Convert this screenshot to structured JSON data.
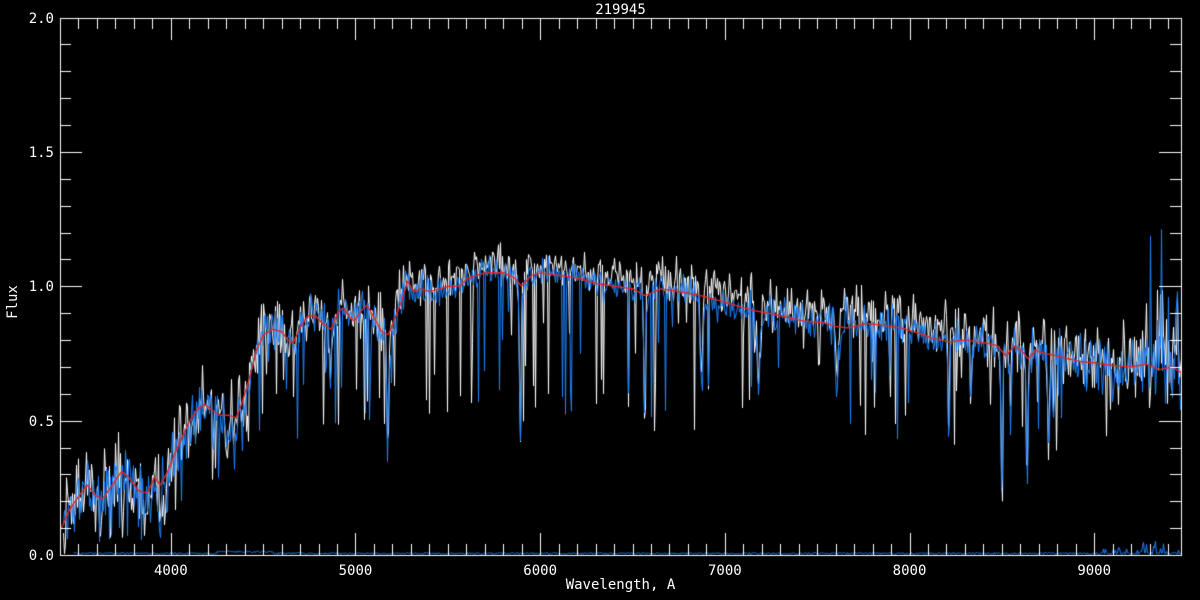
{
  "window": {
    "title": "219945"
  },
  "chart_data": {
    "type": "line",
    "title": "219945",
    "xlabel": "Wavelength, A",
    "ylabel": "Flux",
    "xlim": [
      3400,
      9470
    ],
    "ylim": [
      0.0,
      2.0
    ],
    "grid": false,
    "legend": null,
    "background_color": "#000000",
    "axis_color": "#ffffff",
    "x_major_ticks": [
      4000,
      5000,
      6000,
      7000,
      8000,
      9000
    ],
    "x_tick_labels": [
      "4000",
      "5000",
      "6000",
      "7000",
      "8000",
      "9000"
    ],
    "x_minor_step": 100,
    "y_major_ticks": [
      0.0,
      0.5,
      1.0,
      1.5,
      2.0
    ],
    "y_tick_labels": [
      "0.0",
      "0.5",
      "1.0",
      "1.5",
      "2.0"
    ],
    "y_minor_step": 0.1,
    "data_start": 3415,
    "continuum_x": [
      3405,
      3450,
      3500,
      3545,
      3590,
      3630,
      3680,
      3730,
      3770,
      3820,
      3870,
      3910,
      3940,
      3980,
      4020,
      4060,
      4100,
      4140,
      4180,
      4220,
      4260,
      4310,
      4350,
      4380,
      4420,
      4460,
      4500,
      4550,
      4600,
      4630,
      4660,
      4700,
      4740,
      4780,
      4820,
      4865,
      4900,
      4930,
      4960,
      4990,
      5030,
      5060,
      5100,
      5140,
      5175,
      5210,
      5250,
      5280,
      5310,
      5350,
      5400,
      5450,
      5500,
      5560,
      5605,
      5650,
      5700,
      5750,
      5800,
      5860,
      5895,
      5950,
      6000,
      6100,
      6200,
      6300,
      6400,
      6500,
      6565,
      6650,
      6750,
      6865,
      6950,
      7050,
      7150,
      7230,
      7330,
      7430,
      7530,
      7600,
      7665,
      7770,
      7850,
      7950,
      8050,
      8120,
      8210,
      8300,
      8400,
      8470,
      8520,
      8560,
      8600,
      8640,
      8680,
      8700,
      8800,
      8920,
      9000,
      9100,
      9200,
      9280,
      9350,
      9420,
      9465
    ],
    "continuum_y": [
      0.1,
      0.17,
      0.22,
      0.26,
      0.22,
      0.21,
      0.26,
      0.31,
      0.29,
      0.24,
      0.23,
      0.29,
      0.26,
      0.31,
      0.38,
      0.44,
      0.5,
      0.54,
      0.56,
      0.54,
      0.52,
      0.52,
      0.51,
      0.56,
      0.65,
      0.76,
      0.82,
      0.84,
      0.83,
      0.8,
      0.79,
      0.85,
      0.89,
      0.89,
      0.86,
      0.84,
      0.9,
      0.92,
      0.89,
      0.87,
      0.91,
      0.93,
      0.88,
      0.83,
      0.82,
      0.88,
      0.95,
      1.02,
      0.98,
      0.99,
      0.98,
      0.99,
      1.0,
      1.0,
      1.03,
      1.04,
      1.05,
      1.05,
      1.05,
      1.03,
      1.0,
      1.04,
      1.05,
      1.04,
      1.03,
      1.01,
      1.0,
      0.99,
      0.965,
      0.99,
      0.98,
      0.965,
      0.95,
      0.93,
      0.91,
      0.9,
      0.885,
      0.87,
      0.865,
      0.85,
      0.845,
      0.862,
      0.855,
      0.845,
      0.825,
      0.807,
      0.793,
      0.8,
      0.79,
      0.78,
      0.74,
      0.775,
      0.765,
      0.73,
      0.762,
      0.755,
      0.74,
      0.72,
      0.715,
      0.705,
      0.7,
      0.71,
      0.69,
      0.7,
      0.68
    ],
    "noise_amp_x": [
      3405,
      4000,
      4400,
      4800,
      5300,
      5800,
      6300,
      6900,
      7400,
      7900,
      8400,
      8900,
      9150,
      9470
    ],
    "noise_amp_y": [
      0.075,
      0.068,
      0.055,
      0.05,
      0.042,
      0.035,
      0.033,
      0.038,
      0.045,
      0.05,
      0.052,
      0.055,
      0.07,
      0.1
    ],
    "absorption_features": [
      {
        "c": 3933,
        "w": 14,
        "d": 0.4
      },
      {
        "c": 3968,
        "w": 12,
        "d": 0.35
      },
      {
        "c": 4101,
        "w": 10,
        "d": 0.25
      },
      {
        "c": 4227,
        "w": 8,
        "d": 0.3
      },
      {
        "c": 4300,
        "w": 20,
        "d": 0.28
      },
      {
        "c": 4340,
        "w": 10,
        "d": 0.28
      },
      {
        "c": 4383,
        "w": 8,
        "d": 0.3
      },
      {
        "c": 4861,
        "w": 10,
        "d": 0.32
      },
      {
        "c": 5172,
        "w": 14,
        "d": 0.42
      },
      {
        "c": 5890,
        "w": 12,
        "d": 0.58
      },
      {
        "c": 6563,
        "w": 10,
        "d": 0.52
      },
      {
        "c": 6870,
        "w": 16,
        "d": 0.33
      },
      {
        "c": 7180,
        "w": 20,
        "d": 0.3
      },
      {
        "c": 7605,
        "w": 18,
        "d": 0.3
      },
      {
        "c": 8210,
        "w": 12,
        "d": 0.4
      },
      {
        "c": 8330,
        "w": 10,
        "d": 0.3
      },
      {
        "c": 8498,
        "w": 10,
        "d": 0.72
      },
      {
        "c": 8545,
        "w": 8,
        "d": 0.35
      },
      {
        "c": 8635,
        "w": 10,
        "d": 0.72
      },
      {
        "c": 8750,
        "w": 12,
        "d": 0.4
      },
      {
        "c": 8775,
        "w": 8,
        "d": 0.35
      }
    ],
    "up_artifacts": [
      {
        "from": 7590,
        "to": 7680,
        "chance": 0.3,
        "max": 0.13
      },
      {
        "from": 9270,
        "to": 9460,
        "chance": 0.28,
        "max": 0.55
      }
    ],
    "series": [
      {
        "name": "observed-spectrum-white",
        "color": "#ffffff",
        "style": "noisy",
        "seed": 7,
        "noise_scale": 1.35,
        "dip_chance": 0.06,
        "dip_max": 0.55,
        "artifact_scale": 0.5,
        "offset_x": [
          3405,
          5000,
          5600,
          6500,
          7500,
          8300,
          9470
        ],
        "offset_y": [
          0.01,
          0.02,
          0.035,
          0.045,
          0.04,
          0.03,
          0.02
        ]
      },
      {
        "name": "flux-spectrum-blue",
        "color": "#1e82fa",
        "style": "noisy",
        "seed": 3,
        "noise_scale": 1.0,
        "dip_chance": 0.05,
        "dip_max": 0.5,
        "artifact_scale": 1.0,
        "offset_x": [
          3405,
          9470
        ],
        "offset_y": [
          0,
          0
        ]
      },
      {
        "name": "template-fit-red",
        "color": "#e02828",
        "style": "smooth"
      },
      {
        "name": "error-spectrum-blue",
        "color": "#1e82fa",
        "style": "error",
        "seed": 11,
        "base": 0.006,
        "noise": 0.0035,
        "start": 3470,
        "bump_from": 4250,
        "bump_to": 4550,
        "bump": 0.006,
        "spike_from": 9040,
        "spike_chance": 0.3,
        "spike_max": 0.05
      }
    ]
  }
}
